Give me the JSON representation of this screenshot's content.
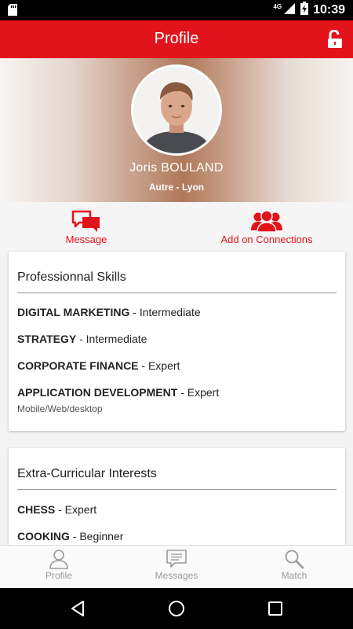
{
  "status_bar": {
    "time": "10:39",
    "network": "4G"
  },
  "app_bar": {
    "title": "Profile"
  },
  "profile": {
    "name": "Joris BOULAND",
    "subtitle": "Autre - Lyon"
  },
  "actions": {
    "message_label": "Message",
    "connect_label": "Add on Connections"
  },
  "skills": {
    "title": "Professionnal Skills",
    "items": [
      {
        "name": "DIGITAL MARKETING",
        "level": " - Intermediate"
      },
      {
        "name": "STRATEGY",
        "level": " - Intermediate"
      },
      {
        "name": "CORPORATE FINANCE",
        "level": " - Expert"
      },
      {
        "name": "APPLICATION DEVELOPMENT",
        "level": " - Expert",
        "note": "Mobile/Web/desktop"
      }
    ]
  },
  "interests": {
    "title": "Extra-Curricular Interests",
    "items": [
      {
        "name": "CHESS",
        "level": " - Expert"
      },
      {
        "name": "COOKING",
        "level": " - Beginner"
      }
    ]
  },
  "bottom_nav": {
    "profile": "Profile",
    "messages": "Messages",
    "match": "Match"
  },
  "colors": {
    "accent": "#e2131b",
    "nav_inactive": "#9a9a9a"
  }
}
